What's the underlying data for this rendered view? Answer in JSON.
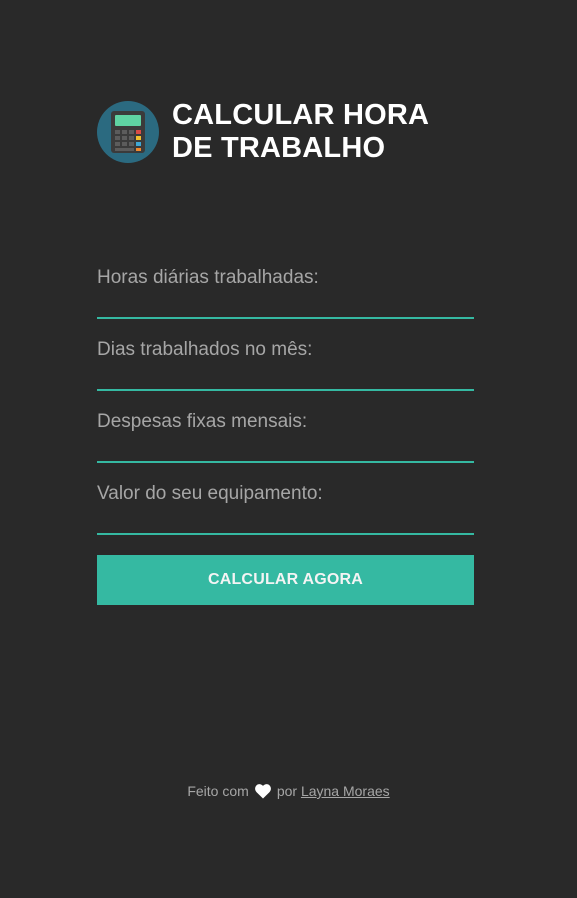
{
  "header": {
    "logo_icon": "calculator-icon",
    "title_line1": "CALCULAR HORA",
    "title_line2": "DE TRABALHO"
  },
  "form": {
    "fields": [
      {
        "label": "Horas diárias trabalhadas:",
        "value": ""
      },
      {
        "label": "Dias trabalhados no mês:",
        "value": ""
      },
      {
        "label": "Despesas fixas mensais:",
        "value": ""
      },
      {
        "label": "Valor do seu equipamento:",
        "value": ""
      }
    ],
    "submit_label": "CALCULAR AGORA"
  },
  "footer": {
    "prefix": "Feito com",
    "heart_icon": "heart-icon",
    "middle": "por",
    "author": "Layna Moraes"
  },
  "colors": {
    "background": "#292929",
    "accent": "#35b9a2",
    "logo_bg": "#2b6a80",
    "label": "#a6a6a6",
    "title": "#ffffff"
  }
}
